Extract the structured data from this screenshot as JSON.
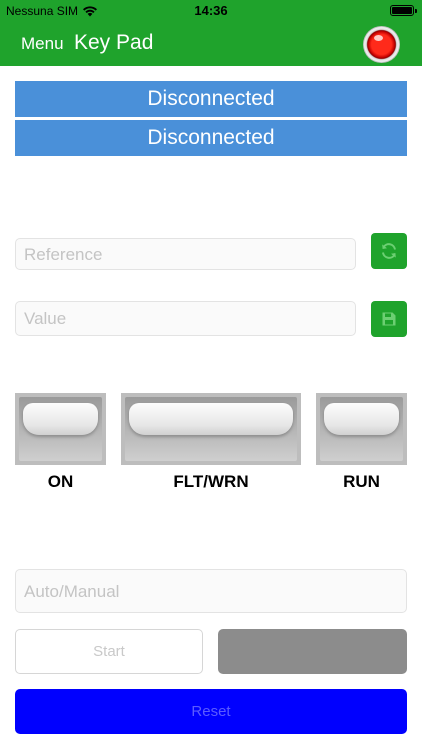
{
  "status_bar": {
    "carrier": "Nessuna SIM",
    "time": "14:36"
  },
  "nav": {
    "menu_label": "Menu",
    "title": "Key Pad",
    "connection_led_color": "#e00000"
  },
  "banners": [
    {
      "text": "Disconnected"
    },
    {
      "text": "Disconnected"
    }
  ],
  "reference": {
    "placeholder": "Reference",
    "button_icon": "refresh-icon"
  },
  "value": {
    "placeholder": "Value",
    "button_icon": "save-icon"
  },
  "indicators": [
    {
      "label": "ON"
    },
    {
      "label": "FLT/WRN"
    },
    {
      "label": "RUN"
    }
  ],
  "mode": {
    "placeholder": "Auto/Manual"
  },
  "controls": {
    "start_label": "Start",
    "stop_label": "",
    "reset_label": "Reset"
  },
  "colors": {
    "accent": "#1fa32c",
    "banner": "#4a90d9",
    "reset": "#0000ff",
    "stop": "#8c8c8c"
  }
}
